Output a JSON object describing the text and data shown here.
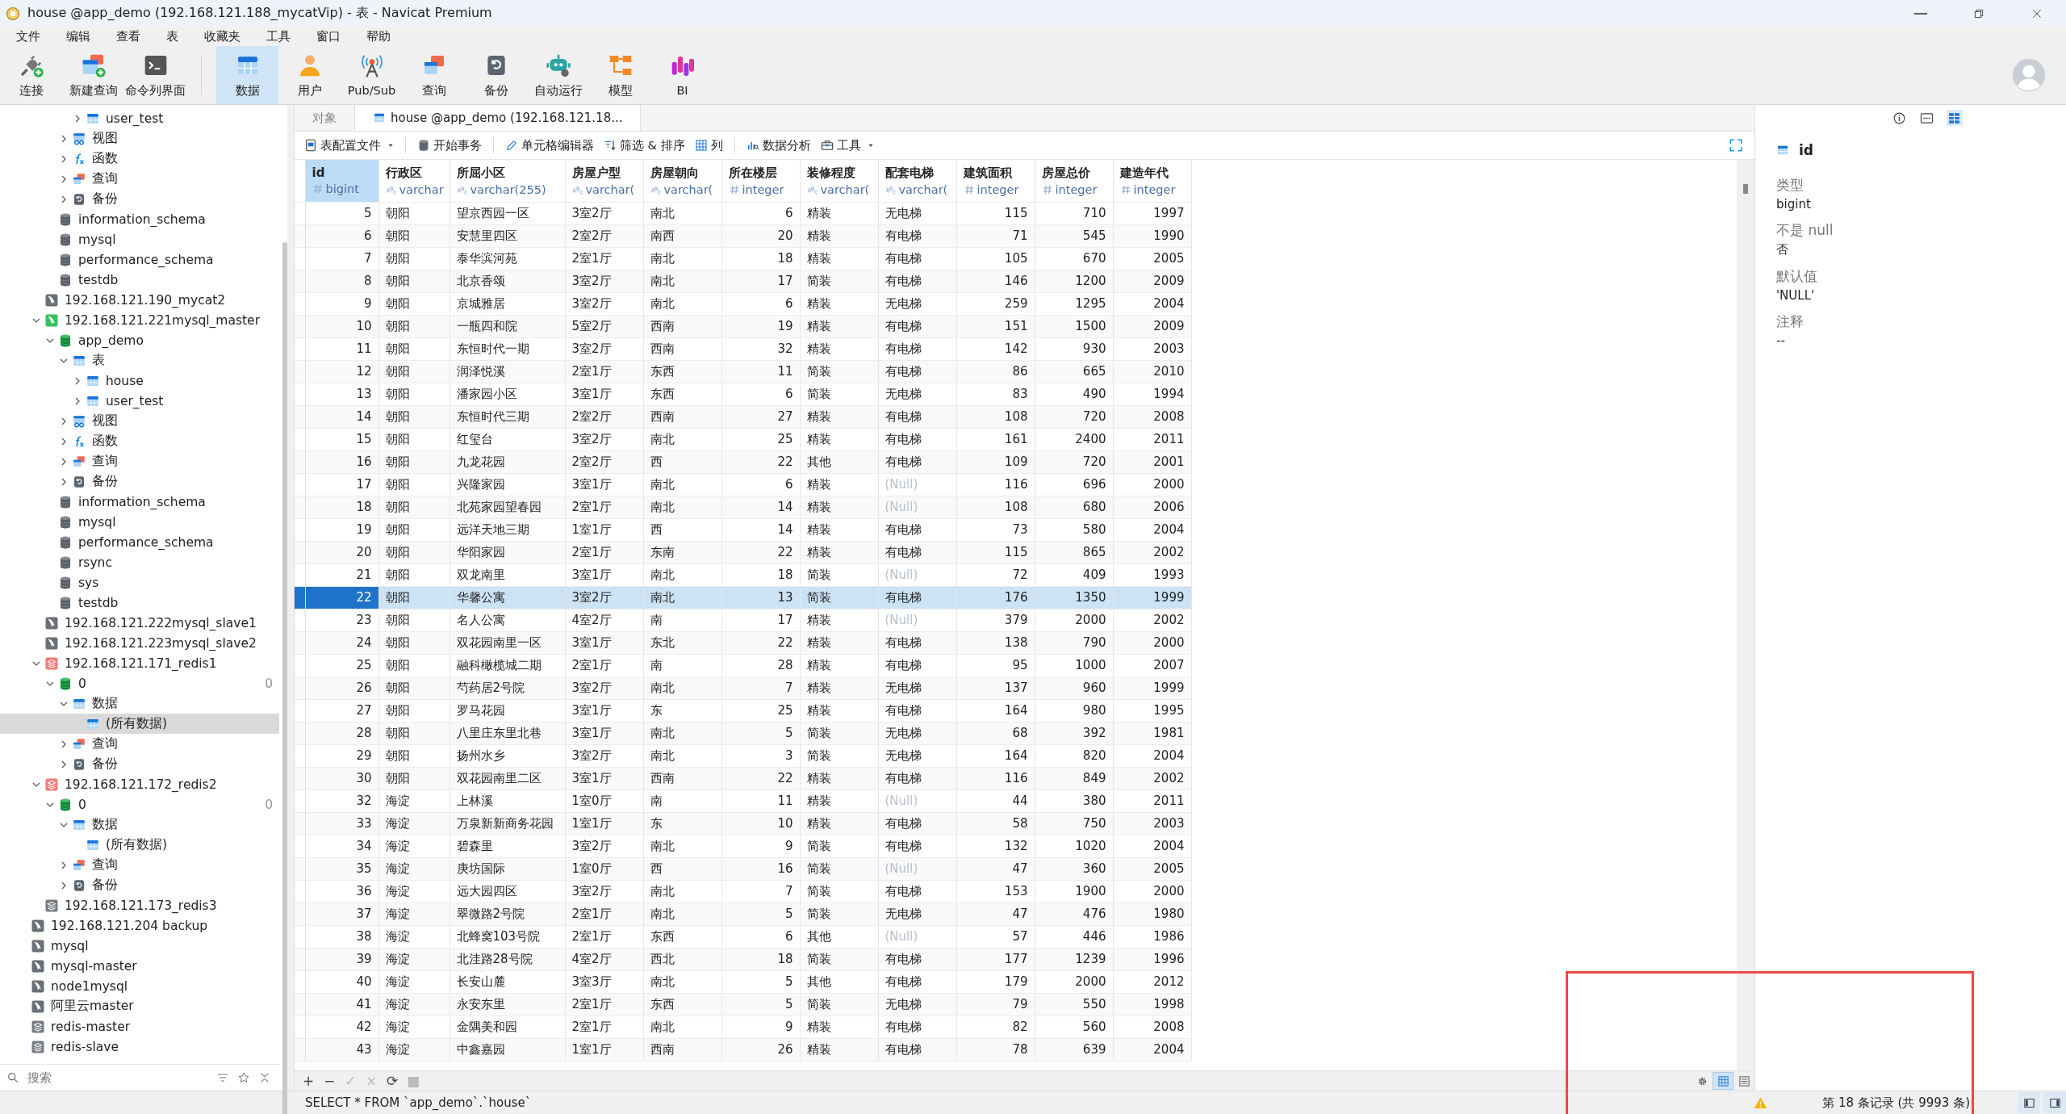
{
  "window": {
    "title": "house @app_demo (192.168.121.188_mycatVip) - 表 - Navicat Premium"
  },
  "menu": [
    "文件",
    "编辑",
    "查看",
    "表",
    "收藏夹",
    "工具",
    "窗口",
    "帮助"
  ],
  "toolbar": {
    "groups": [
      [
        {
          "label": "连接",
          "kind": "plug",
          "selected": false
        },
        {
          "label": "新建查询",
          "kind": "newquery",
          "selected": false
        },
        {
          "label": "命令列界面",
          "kind": "terminal",
          "selected": false
        }
      ],
      [
        {
          "label": "数据",
          "kind": "table",
          "selected": true
        },
        {
          "label": "用户",
          "kind": "user",
          "selected": false
        },
        {
          "label": "Pub/Sub",
          "kind": "antenna",
          "selected": false
        },
        {
          "label": "查询",
          "kind": "query",
          "selected": false
        },
        {
          "label": "备份",
          "kind": "backup",
          "selected": false
        },
        {
          "label": "自动运行",
          "kind": "robot",
          "selected": false
        },
        {
          "label": "模型",
          "kind": "model",
          "selected": false
        },
        {
          "label": "BI",
          "kind": "bi",
          "selected": false
        }
      ]
    ]
  },
  "sidebar": {
    "search": {
      "placeholder": "搜索"
    },
    "tree": [
      {
        "kind": "continued",
        "children": [
          {
            "kind": "continued",
            "children": [
              {
                "kind": "continued",
                "children": [
                  {
                    "kind": "continued",
                    "children": [
                      {
                        "label": "user_test",
                        "kind": "table",
                        "expanded": false,
                        "selected": false
                      }
                    ]
                  },
                  {
                    "label": "视图",
                    "kind": "view",
                    "expanded": false,
                    "selected": false
                  },
                  {
                    "label": "函数",
                    "kind": "function",
                    "expanded": false,
                    "selected": false
                  },
                  {
                    "label": "查询",
                    "kind": "query",
                    "expanded": false,
                    "selected": false
                  },
                  {
                    "label": "备份",
                    "kind": "backup",
                    "expanded": false,
                    "selected": false
                  }
                ]
              },
              {
                "label": "information_schema",
                "kind": "database",
                "selected": false
              },
              {
                "label": "mysql",
                "kind": "database",
                "selected": false
              },
              {
                "label": "performance_schema",
                "kind": "database",
                "selected": false
              },
              {
                "label": "testdb",
                "kind": "database",
                "selected": false
              }
            ]
          },
          {
            "label": "192.168.121.190_mycat2",
            "kind": "mysql",
            "selected": false
          },
          {
            "label": "192.168.121.221mysql_master",
            "kind": "mysql_active",
            "expanded": true,
            "selected": false,
            "children": [
              {
                "label": "app_demo",
                "kind": "database_active",
                "expanded": true,
                "selected": false,
                "children": [
                  {
                    "label": "表",
                    "kind": "table",
                    "expanded": true,
                    "selected": false,
                    "children": [
                      {
                        "label": "house",
                        "kind": "table",
                        "expanded": false,
                        "selected": false
                      },
                      {
                        "label": "user_test",
                        "kind": "table",
                        "expanded": false,
                        "selected": false
                      }
                    ]
                  },
                  {
                    "label": "视图",
                    "kind": "view",
                    "expanded": false,
                    "selected": false
                  },
                  {
                    "label": "函数",
                    "kind": "function",
                    "expanded": false,
                    "selected": false
                  },
                  {
                    "label": "查询",
                    "kind": "query",
                    "expanded": false,
                    "selected": false
                  },
                  {
                    "label": "备份",
                    "kind": "backup",
                    "expanded": false,
                    "selected": false
                  }
                ]
              },
              {
                "label": "information_schema",
                "kind": "database",
                "selected": false
              },
              {
                "label": "mysql",
                "kind": "database",
                "selected": false
              },
              {
                "label": "performance_schema",
                "kind": "database",
                "selected": false
              },
              {
                "label": "rsync",
                "kind": "database",
                "selected": false
              },
              {
                "label": "sys",
                "kind": "database",
                "selected": false
              },
              {
                "label": "testdb",
                "kind": "database",
                "selected": false
              }
            ]
          },
          {
            "label": "192.168.121.222mysql_slave1",
            "kind": "mysql",
            "selected": false
          },
          {
            "label": "192.168.121.223mysql_slave2",
            "kind": "mysql",
            "selected": false
          },
          {
            "label": "192.168.121.171_redis1",
            "kind": "redis_active",
            "expanded": true,
            "selected": false,
            "children": [
              {
                "label": "0",
                "kind": "database_active",
                "expanded": true,
                "selected": false,
                "count": "0",
                "children": [
                  {
                    "label": "数据",
                    "kind": "table",
                    "expanded": true,
                    "selected": false,
                    "children": [
                      {
                        "label": "(所有数据)",
                        "kind": "table",
                        "selected": true
                      }
                    ]
                  },
                  {
                    "label": "查询",
                    "kind": "query",
                    "expanded": false,
                    "selected": false
                  },
                  {
                    "label": "备份",
                    "kind": "backup",
                    "expanded": false,
                    "selected": false
                  }
                ]
              }
            ]
          },
          {
            "label": "192.168.121.172_redis2",
            "kind": "redis_active",
            "expanded": true,
            "selected": false,
            "children": [
              {
                "label": "0",
                "kind": "database_active",
                "expanded": true,
                "selected": false,
                "count": "0",
                "children": [
                  {
                    "label": "数据",
                    "kind": "table",
                    "expanded": true,
                    "selected": false,
                    "children": [
                      {
                        "label": "(所有数据)",
                        "kind": "table",
                        "selected": false
                      }
                    ]
                  },
                  {
                    "label": "查询",
                    "kind": "query",
                    "expanded": false,
                    "selected": false
                  },
                  {
                    "label": "备份",
                    "kind": "backup",
                    "expanded": false,
                    "selected": false
                  }
                ]
              }
            ]
          },
          {
            "label": "192.168.121.173_redis3",
            "kind": "redis",
            "selected": false
          }
        ]
      },
      {
        "label": "192.168.121.204 backup",
        "kind": "mysql",
        "selected": false
      },
      {
        "label": "mysql",
        "kind": "mysql",
        "selected": false
      },
      {
        "label": "mysql-master",
        "kind": "mysql",
        "selected": false
      },
      {
        "label": "node1mysql",
        "kind": "mysql",
        "selected": false
      },
      {
        "label": "阿里云master",
        "kind": "mysql",
        "selected": false
      },
      {
        "label": "redis-master",
        "kind": "redis",
        "selected": false
      },
      {
        "label": "redis-slave",
        "kind": "redis",
        "selected": false
      }
    ]
  },
  "tabs": [
    {
      "label": "对象",
      "kind": "plain",
      "selected": false
    },
    {
      "label": "house @app_demo (192.168.121.18...",
      "kind": "table",
      "selected": true
    }
  ],
  "table_toolbar": {
    "groups": [
      [
        {
          "label": "表配置文件",
          "kind": "document",
          "dropdown": true
        }
      ],
      [
        {
          "label": "开始事务",
          "kind": "database",
          "dropdown": false
        }
      ],
      [
        {
          "label": "单元格编辑器",
          "kind": "pencil",
          "dropdown": false
        },
        {
          "label": "筛选 & 排序",
          "kind": "filter",
          "dropdown": false
        },
        {
          "label": "列",
          "kind": "grid",
          "dropdown": false
        }
      ],
      [
        {
          "label": "数据分析",
          "kind": "analysis",
          "dropdown": false
        },
        {
          "label": "工具",
          "kind": "toolbox",
          "dropdown": true
        }
      ]
    ]
  },
  "table": {
    "columns": [
      {
        "name": "id",
        "type": "bigint",
        "kind": "number",
        "selected": true
      },
      {
        "name": "行政区",
        "type": "varchar",
        "kind": "text",
        "selected": false
      },
      {
        "name": "所屈小区",
        "type": "varchar(255)",
        "kind": "text",
        "selected": false
      },
      {
        "name": "房屋户型",
        "type": "varchar(",
        "kind": "text",
        "selected": false
      },
      {
        "name": "房屋朝向",
        "type": "varchar(",
        "kind": "text",
        "selected": false
      },
      {
        "name": "所在楼层",
        "type": "integer",
        "kind": "number",
        "selected": false
      },
      {
        "name": "装修程度",
        "type": "varchar(",
        "kind": "text",
        "selected": false
      },
      {
        "name": "配套电梯",
        "type": "varchar(",
        "kind": "text",
        "selected": false
      },
      {
        "name": "建筑面积",
        "type": "integer",
        "kind": "number",
        "selected": false
      },
      {
        "name": "房屋总价",
        "type": "integer",
        "kind": "number",
        "selected": false
      },
      {
        "name": "建造年代",
        "type": "integer",
        "kind": "number",
        "selected": false
      }
    ],
    "rows": [
      {
        "selected": false,
        "cells": [
          "5",
          "朝阳",
          "望京西园一区",
          "3室2厅",
          "南北",
          "6",
          "精装",
          "无电梯",
          "115",
          "710",
          "1997"
        ]
      },
      {
        "selected": false,
        "cells": [
          "6",
          "朝阳",
          "安慧里四区",
          "2室2厅",
          "南西",
          "20",
          "精装",
          "有电梯",
          "71",
          "545",
          "1990"
        ]
      },
      {
        "selected": false,
        "cells": [
          "7",
          "朝阳",
          "泰华滨河苑",
          "2室1厅",
          "南北",
          "18",
          "精装",
          "有电梯",
          "105",
          "670",
          "2005"
        ]
      },
      {
        "selected": false,
        "cells": [
          "8",
          "朝阳",
          "北京香颂",
          "3室2厅",
          "南北",
          "17",
          "简装",
          "有电梯",
          "146",
          "1200",
          "2009"
        ]
      },
      {
        "selected": false,
        "cells": [
          "9",
          "朝阳",
          "京城雅居",
          "3室2厅",
          "南北",
          "6",
          "精装",
          "无电梯",
          "259",
          "1295",
          "2004"
        ]
      },
      {
        "selected": false,
        "cells": [
          "10",
          "朝阳",
          "一瓶四和院",
          "5室2厅",
          "西南",
          "19",
          "精装",
          "有电梯",
          "151",
          "1500",
          "2009"
        ]
      },
      {
        "selected": false,
        "cells": [
          "11",
          "朝阳",
          "东恒时代一期",
          "3室2厅",
          "西南",
          "32",
          "精装",
          "有电梯",
          "142",
          "930",
          "2003"
        ]
      },
      {
        "selected": false,
        "cells": [
          "12",
          "朝阳",
          "润泽悦溪",
          "2室1厅",
          "东西",
          "11",
          "简装",
          "有电梯",
          "86",
          "665",
          "2010"
        ]
      },
      {
        "selected": false,
        "cells": [
          "13",
          "朝阳",
          "潘家园小区",
          "3室1厅",
          "东西",
          "6",
          "简装",
          "无电梯",
          "83",
          "490",
          "1994"
        ]
      },
      {
        "selected": false,
        "cells": [
          "14",
          "朝阳",
          "东恒时代三期",
          "2室2厅",
          "西南",
          "27",
          "精装",
          "有电梯",
          "108",
          "720",
          "2008"
        ]
      },
      {
        "selected": false,
        "cells": [
          "15",
          "朝阳",
          "红玺台",
          "3室2厅",
          "南北",
          "25",
          "精装",
          "有电梯",
          "161",
          "2400",
          "2011"
        ]
      },
      {
        "selected": false,
        "cells": [
          "16",
          "朝阳",
          "九龙花园",
          "2室2厅",
          "西",
          "22",
          "其他",
          "有电梯",
          "109",
          "720",
          "2001"
        ]
      },
      {
        "selected": false,
        "cells": [
          "17",
          "朝阳",
          "兴隆家园",
          "3室1厅",
          "南北",
          "6",
          "精装",
          {
            "kind": "null",
            "text": "(Null)"
          },
          "116",
          "696",
          "2000"
        ]
      },
      {
        "selected": false,
        "cells": [
          "18",
          "朝阳",
          "北苑家园望春园",
          "2室1厅",
          "南北",
          "14",
          "精装",
          {
            "kind": "null",
            "text": "(Null)"
          },
          "108",
          "680",
          "2006"
        ]
      },
      {
        "selected": false,
        "cells": [
          "19",
          "朝阳",
          "远洋天地三期",
          "1室1厅",
          "西",
          "14",
          "精装",
          "有电梯",
          "73",
          "580",
          "2004"
        ]
      },
      {
        "selected": false,
        "cells": [
          "20",
          "朝阳",
          "华阳家园",
          "2室1厅",
          "东南",
          "22",
          "精装",
          "有电梯",
          "115",
          "865",
          "2002"
        ]
      },
      {
        "selected": false,
        "cells": [
          "21",
          "朝阳",
          "双龙南里",
          "3室1厅",
          "南北",
          "18",
          "简装",
          {
            "kind": "null",
            "text": "(Null)"
          },
          "72",
          "409",
          "1993"
        ]
      },
      {
        "selected": true,
        "cells": [
          "22",
          "朝阳",
          "华馨公寓",
          "3室2厅",
          "南北",
          "13",
          "简装",
          "有电梯",
          "176",
          "1350",
          "1999"
        ]
      },
      {
        "selected": false,
        "cells": [
          "23",
          "朝阳",
          "名人公寓",
          "4室2厅",
          "南",
          "17",
          "精装",
          {
            "kind": "null",
            "text": "(Null)"
          },
          "379",
          "2000",
          "2002"
        ]
      },
      {
        "selected": false,
        "cells": [
          "24",
          "朝阳",
          "双花园南里一区",
          "3室1厅",
          "东北",
          "22",
          "精装",
          "有电梯",
          "138",
          "790",
          "2000"
        ]
      },
      {
        "selected": false,
        "cells": [
          "25",
          "朝阳",
          "融科橄榄城二期",
          "2室1厅",
          "南",
          "28",
          "精装",
          "有电梯",
          "95",
          "1000",
          "2007"
        ]
      },
      {
        "selected": false,
        "cells": [
          "26",
          "朝阳",
          "芍药居2号院",
          "3室2厅",
          "南北",
          "7",
          "精装",
          "无电梯",
          "137",
          "960",
          "1999"
        ]
      },
      {
        "selected": false,
        "cells": [
          "27",
          "朝阳",
          "罗马花园",
          "3室1厅",
          "东",
          "25",
          "精装",
          "有电梯",
          "164",
          "980",
          "1995"
        ]
      },
      {
        "selected": false,
        "cells": [
          "28",
          "朝阳",
          "八里庄东里北巷",
          "3室1厅",
          "南北",
          "5",
          "简装",
          "无电梯",
          "68",
          "392",
          "1981"
        ]
      },
      {
        "selected": false,
        "cells": [
          "29",
          "朝阳",
          "扬州水乡",
          "3室2厅",
          "南北",
          "3",
          "简装",
          "无电梯",
          "164",
          "820",
          "2004"
        ]
      },
      {
        "selected": false,
        "cells": [
          "30",
          "朝阳",
          "双花园南里二区",
          "3室1厅",
          "西南",
          "22",
          "精装",
          "有电梯",
          "116",
          "849",
          "2002"
        ]
      },
      {
        "selected": false,
        "cells": [
          "32",
          "海淀",
          "上林溪",
          "1室0厅",
          "南",
          "11",
          "精装",
          {
            "kind": "null",
            "text": "(Null)"
          },
          "44",
          "380",
          "2011"
        ]
      },
      {
        "selected": false,
        "cells": [
          "33",
          "海淀",
          "万泉新新商务花园",
          "1室1厅",
          "东",
          "10",
          "精装",
          "有电梯",
          "58",
          "750",
          "2003"
        ]
      },
      {
        "selected": false,
        "cells": [
          "34",
          "海淀",
          "碧森里",
          "3室2厅",
          "南北",
          "9",
          "简装",
          "有电梯",
          "132",
          "1020",
          "2004"
        ]
      },
      {
        "selected": false,
        "cells": [
          "35",
          "海淀",
          "庚坊国际",
          "1室0厅",
          "西",
          "16",
          "简装",
          {
            "kind": "null",
            "text": "(Null)"
          },
          "47",
          "360",
          "2005"
        ]
      },
      {
        "selected": false,
        "cells": [
          "36",
          "海淀",
          "远大园四区",
          "3室2厅",
          "南北",
          "7",
          "简装",
          "有电梯",
          "153",
          "1900",
          "2000"
        ]
      },
      {
        "selected": false,
        "cells": [
          "37",
          "海淀",
          "翠微路2号院",
          "2室1厅",
          "南北",
          "5",
          "简装",
          "无电梯",
          "47",
          "476",
          "1980"
        ]
      },
      {
        "selected": false,
        "cells": [
          "38",
          "海淀",
          "北蜂窝103号院",
          "2室1厅",
          "东西",
          "6",
          "其他",
          {
            "kind": "null",
            "text": "(Null)"
          },
          "57",
          "446",
          "1986"
        ]
      },
      {
        "selected": false,
        "cells": [
          "39",
          "海淀",
          "北洼路28号院",
          "4室2厅",
          "西北",
          "18",
          "简装",
          "有电梯",
          "177",
          "1239",
          "1996"
        ]
      },
      {
        "selected": false,
        "cells": [
          "40",
          "海淀",
          "长安山麓",
          "3室3厅",
          "南北",
          "5",
          "其他",
          "有电梯",
          "179",
          "2000",
          "2012"
        ]
      },
      {
        "selected": false,
        "cells": [
          "41",
          "海淀",
          "永安东里",
          "2室1厅",
          "东西",
          "5",
          "简装",
          "无电梯",
          "79",
          "550",
          "1998"
        ]
      },
      {
        "selected": false,
        "cells": [
          "42",
          "海淀",
          "金隅美和园",
          "2室1厅",
          "南北",
          "9",
          "精装",
          "有电梯",
          "82",
          "560",
          "2008"
        ]
      },
      {
        "selected": false,
        "cells": [
          "43",
          "海淀",
          "中鑫嘉园",
          "1室1厅",
          "西南",
          "26",
          "精装",
          "有电梯",
          "78",
          "639",
          "2004"
        ]
      }
    ]
  },
  "grid_actions": [
    {
      "symbol": "+",
      "disabled": false
    },
    {
      "symbol": "−",
      "disabled": false
    },
    {
      "symbol": "✓",
      "disabled": true
    },
    {
      "symbol": "×",
      "disabled": true
    },
    {
      "symbol": "⟳",
      "disabled": false
    },
    {
      "symbol": "■",
      "disabled": true
    }
  ],
  "view_modes": [
    {
      "kind": "settings",
      "selected": false
    },
    {
      "kind": "grid",
      "selected": true
    },
    {
      "kind": "form",
      "selected": false
    }
  ],
  "details": {
    "tabs": [
      {
        "kind": "info",
        "selected": false
      },
      {
        "kind": "ddl",
        "selected": false
      },
      {
        "kind": "fields",
        "selected": true
      }
    ],
    "field": "id",
    "properties": [
      {
        "label": "类型",
        "value": "bigint"
      },
      {
        "label": "不是 null",
        "value": "否"
      },
      {
        "label": "默认值",
        "value": "'NULL'"
      },
      {
        "label": "注释",
        "value": "--"
      }
    ]
  },
  "status_bar": {
    "sql": "SELECT * FROM `app_demo`.`house`",
    "warning": true,
    "records": "第 18 条记录 (共 9993 条)"
  },
  "annotations": [
    {
      "kind": "frame"
    }
  ]
}
